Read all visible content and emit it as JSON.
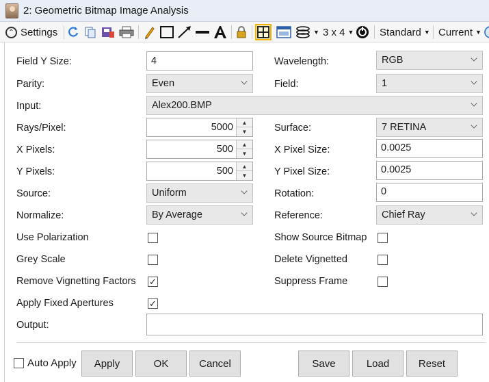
{
  "window": {
    "title": "2: Geometric Bitmap Image Analysis"
  },
  "toolbar": {
    "settings_label": "Settings",
    "layout_label": "3 x 4",
    "standard_label": "Standard",
    "current_label": "Current",
    "icons": [
      "refresh-icon",
      "copy-icon",
      "save-image-icon",
      "print-icon",
      "pencil-icon",
      "rectangle-icon",
      "arrow-line-icon",
      "line-icon",
      "text-icon",
      "lock-icon",
      "crosshair-icon",
      "window-icon",
      "layers-icon",
      "timer-icon"
    ]
  },
  "form": {
    "field_y_size": {
      "label": "Field Y Size:",
      "value": "4"
    },
    "wavelength": {
      "label": "Wavelength:",
      "value": "RGB"
    },
    "parity": {
      "label": "Parity:",
      "value": "Even"
    },
    "field": {
      "label": "Field:",
      "value": "1"
    },
    "input": {
      "label": "Input:",
      "value": "Alex200.BMP"
    },
    "rays_pixel": {
      "label": "Rays/Pixel:",
      "value": "5000"
    },
    "surface": {
      "label": "Surface:",
      "value": "7 RETINA"
    },
    "x_pixels": {
      "label": "X Pixels:",
      "value": "500"
    },
    "x_pixel_size": {
      "label": "X Pixel Size:",
      "value": "0.0025"
    },
    "y_pixels": {
      "label": "Y Pixels:",
      "value": "500"
    },
    "y_pixel_size": {
      "label": "Y Pixel Size:",
      "value": "0.0025"
    },
    "source": {
      "label": "Source:",
      "value": "Uniform"
    },
    "rotation": {
      "label": "Rotation:",
      "value": "0"
    },
    "normalize": {
      "label": "Normalize:",
      "value": "By Average"
    },
    "reference": {
      "label": "Reference:",
      "value": "Chief Ray"
    },
    "use_polarization": {
      "label": "Use Polarization",
      "checked": false
    },
    "show_source_bitmap": {
      "label": "Show Source Bitmap",
      "checked": false
    },
    "grey_scale": {
      "label": "Grey Scale",
      "checked": false
    },
    "delete_vignetted": {
      "label": "Delete Vignetted",
      "checked": false
    },
    "remove_vignetting": {
      "label": "Remove Vignetting Factors",
      "checked": true
    },
    "suppress_frame": {
      "label": "Suppress Frame",
      "checked": false
    },
    "apply_fixed_apertures": {
      "label": "Apply Fixed Apertures",
      "checked": true
    },
    "output": {
      "label": "Output:",
      "value": ""
    }
  },
  "footer": {
    "auto_apply_label": "Auto Apply",
    "auto_apply_checked": false,
    "apply_label": "Apply",
    "ok_label": "OK",
    "cancel_label": "Cancel",
    "save_label": "Save",
    "load_label": "Load",
    "reset_label": "Reset"
  },
  "glyphs": {
    "check": "✓",
    "up": "▲",
    "down": "▼"
  }
}
